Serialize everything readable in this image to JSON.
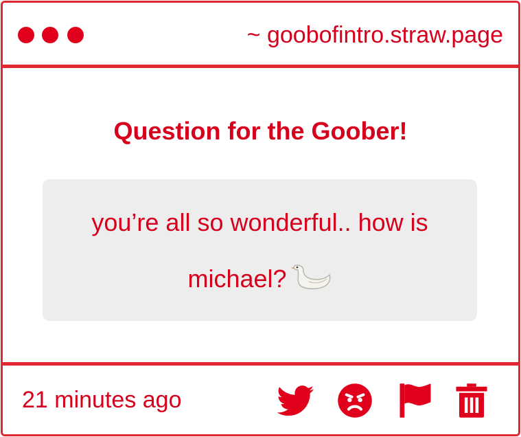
{
  "window": {
    "url": "~ goobofintro.straw.page"
  },
  "main": {
    "heading": "Question for the Goober!",
    "question": "you’re all so wonderful.. how is michael?",
    "question_emoji": "swan-emoji"
  },
  "footer": {
    "timestamp": "21 minutes ago",
    "actions": [
      {
        "icon": "twitter-bird-icon"
      },
      {
        "icon": "angry-face-icon"
      },
      {
        "icon": "flag-icon"
      },
      {
        "icon": "trash-icon"
      }
    ]
  },
  "colors": {
    "accent": "#e0001b",
    "border": "#e0272f",
    "question_bg": "#eeedee",
    "background": "#ffffff"
  }
}
